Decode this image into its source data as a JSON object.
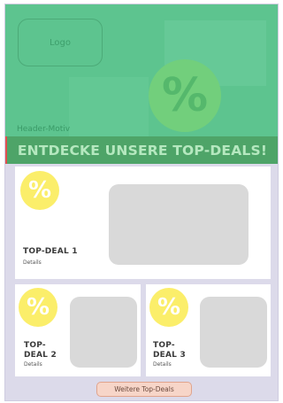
{
  "header": {
    "logo_label": "Logo",
    "header_label": "Header-Motiv",
    "badge_symbol": "%",
    "banner_text": "ENTDECKE UNSERE TOP-DEALS!"
  },
  "deals": [
    {
      "title": "TOP-DEAL 1",
      "details": "Details",
      "badge_symbol": "%"
    },
    {
      "title": "TOP-\nDEAL 2",
      "details": "Details",
      "badge_symbol": "%"
    },
    {
      "title": "TOP-\nDEAL 3",
      "details": "Details",
      "badge_symbol": "%"
    }
  ],
  "more_button": {
    "label": "Weitere Top-Deals"
  },
  "colors": {
    "header_green": "#5dc48f",
    "banner_green": "#4ea468",
    "badge_yellow": "#fbee6a",
    "button_bg": "#f7d5c8",
    "frame_bg": "#dcdaea"
  }
}
